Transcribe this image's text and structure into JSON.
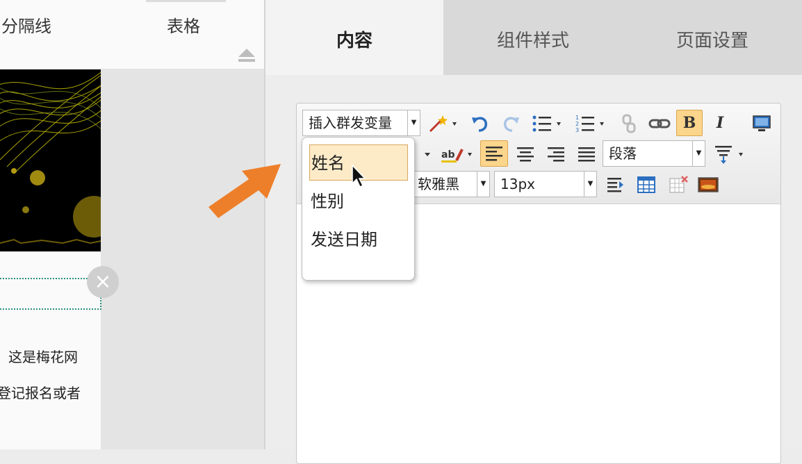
{
  "left_tabs": {
    "divider": "分隔线",
    "table": "表格"
  },
  "preview": {
    "line1": "这是梅花网",
    "line2": "登记报名或者",
    "close_symbol": "×"
  },
  "right_tabs": {
    "content": "内容",
    "style": "组件样式",
    "page": "页面设置"
  },
  "toolbar": {
    "insert_var": "插入群发变量",
    "paragraph": "段落",
    "font_family": "软雅黑",
    "font_size": "13px",
    "bold": "B",
    "italic": "I"
  },
  "dropdown": {
    "items": [
      "姓名",
      "性别",
      "发送日期"
    ],
    "highlighted": "姓名"
  },
  "colors": {
    "accent_orange": "#ee7f2a",
    "active_button": "#fbd58b"
  },
  "icons": [
    "eject-icon",
    "magic-wand-icon",
    "undo-icon",
    "redo-icon",
    "bullet-list-icon",
    "numbered-list-icon",
    "unlink-icon",
    "link-icon",
    "bold-icon",
    "italic-icon",
    "source-icon",
    "highlight-icon",
    "align-left-icon",
    "align-center-icon",
    "align-right-icon",
    "align-justify-icon",
    "line-height-icon",
    "indent-icon",
    "table-icon",
    "delete-table-icon",
    "image-icon",
    "close-icon",
    "arrow-icon",
    "cursor-icon"
  ]
}
